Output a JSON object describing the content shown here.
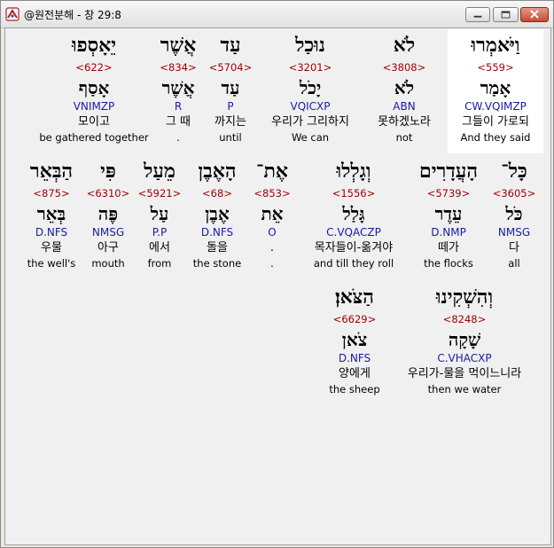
{
  "window": {
    "title": "@원전분해 - 창 29:8"
  },
  "rows": [
    [
      {
        "hebrew": "וַיֹּאמְרוּ",
        "strong": "<559>",
        "lexeme": "אָמַר",
        "morph": "CW.VQIMZP",
        "korean": "그들이 가로되",
        "english": "And they said",
        "highlight": true
      },
      {
        "hebrew": "לֹא",
        "strong": "<3808>",
        "lexeme": "לֹא",
        "morph": "ABN",
        "korean": "못하겠노라",
        "english": "not"
      },
      {
        "hebrew": "נוּכַל",
        "strong": "<3201>",
        "lexeme": "יָכֹל",
        "morph": "VQICXP",
        "korean": "우리가 그리하지",
        "english": "We can"
      },
      {
        "hebrew": "עַד",
        "strong": "<5704>",
        "lexeme": "עַד",
        "morph": "P",
        "korean": "까지는",
        "english": "until"
      },
      {
        "hebrew": "אֲשֶׁר",
        "strong": "<834>",
        "lexeme": "אֲשֶׁר",
        "morph": "R",
        "korean": "그 때",
        "english": "."
      },
      {
        "hebrew": "יֵאָסְפוּ",
        "strong": "<622>",
        "lexeme": "אָסַף",
        "morph": "VNIMZP",
        "korean": "모이고",
        "english": "be gathered together"
      }
    ],
    [
      {
        "hebrew": "כָּל־",
        "strong": "<3605>",
        "lexeme": "כֹּל",
        "morph": "NMSG",
        "korean": "다",
        "english": "all"
      },
      {
        "hebrew": "הָעֲדָרִים",
        "strong": "<5739>",
        "lexeme": "עֵדֶר",
        "morph": "D.NMP",
        "korean": "떼가",
        "english": "the flocks"
      },
      {
        "hebrew": "וְגָלְלוּ",
        "strong": "<1556>",
        "lexeme": "גָּלַל",
        "morph": "C.VQACZP",
        "korean": "목자들이-옮겨야",
        "english": "and till they roll"
      },
      {
        "hebrew": "אֶת־",
        "strong": "<853>",
        "lexeme": "אֵת",
        "morph": "O",
        "korean": ".",
        "english": "."
      },
      {
        "hebrew": "הָאֶבֶן",
        "strong": "<68>",
        "lexeme": "אֶבֶן",
        "morph": "D.NFS",
        "korean": "돌을",
        "english": "the stone"
      },
      {
        "hebrew": "מֵעַל",
        "strong": "<5921>",
        "lexeme": "עַל",
        "morph": "P.P",
        "korean": "에서",
        "english": "from"
      },
      {
        "hebrew": "פִּי",
        "strong": "<6310>",
        "lexeme": "פֶּה",
        "morph": "NMSG",
        "korean": "아구",
        "english": "mouth"
      },
      {
        "hebrew": "הַבְּאֵר",
        "strong": "<875>",
        "lexeme": "בְּאֵר",
        "morph": "D.NFS",
        "korean": "우물",
        "english": "the well's"
      }
    ],
    [
      {
        "hebrew": "וְהִשְׁקִינוּ",
        "strong": "<8248>",
        "lexeme": "שָׁקָה",
        "morph": "C.VHACXP",
        "korean": "우리가-물을 먹이느니라",
        "english": "then we water"
      },
      {
        "hebrew": "הַצֹּאן׃",
        "strong": "<6629>",
        "lexeme": "צֹאן",
        "morph": "D.NFS",
        "korean": "양에게",
        "english": "the sheep"
      }
    ]
  ]
}
